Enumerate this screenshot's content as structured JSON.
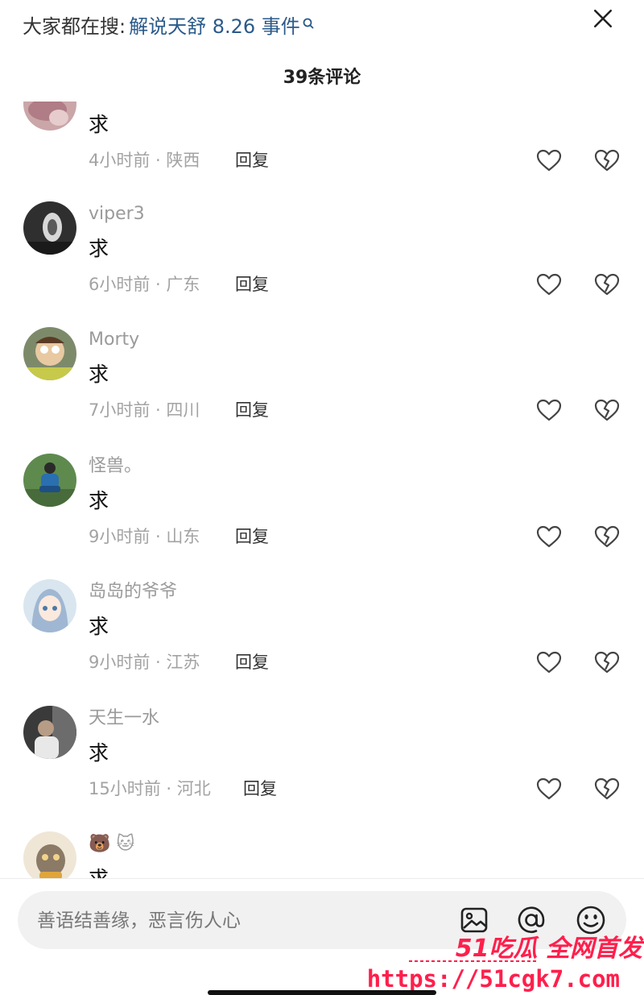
{
  "header": {
    "search_label": "大家都在搜:",
    "search_term": "解说天舒 8.26 事件",
    "comment_count": "39条评论"
  },
  "comments": [
    {
      "username": "",
      "content": "求",
      "time_location": "4小时前 · 陕西",
      "reply": "回复"
    },
    {
      "username": "viper3",
      "content": "求",
      "time_location": "6小时前 · 广东",
      "reply": "回复"
    },
    {
      "username": "Morty",
      "content": "求",
      "time_location": "7小时前 · 四川",
      "reply": "回复"
    },
    {
      "username": "怪兽。",
      "content": "求",
      "time_location": "9小时前 · 山东",
      "reply": "回复"
    },
    {
      "username": "岛岛的爷爷",
      "content": "求",
      "time_location": "9小时前 · 江苏",
      "reply": "回复"
    },
    {
      "username": "天生一水",
      "content": "求",
      "time_location": "15小时前 · 河北",
      "reply": "回复"
    },
    {
      "username": "🐻 🐱",
      "content": "求",
      "time_location": "",
      "reply": ""
    }
  ],
  "input": {
    "placeholder": "善语结善缘，恶言伤人心"
  },
  "watermark": {
    "line1": "51吃瓜 全网首发",
    "line2": "https://51cgk7.com"
  },
  "colors": {
    "accent_link": "#2a5a8a",
    "watermark": "#ff1f4c"
  },
  "icons": [
    "search-icon",
    "close-icon",
    "heart-icon",
    "broken-heart-icon",
    "image-icon",
    "at-icon",
    "emoji-icon"
  ]
}
